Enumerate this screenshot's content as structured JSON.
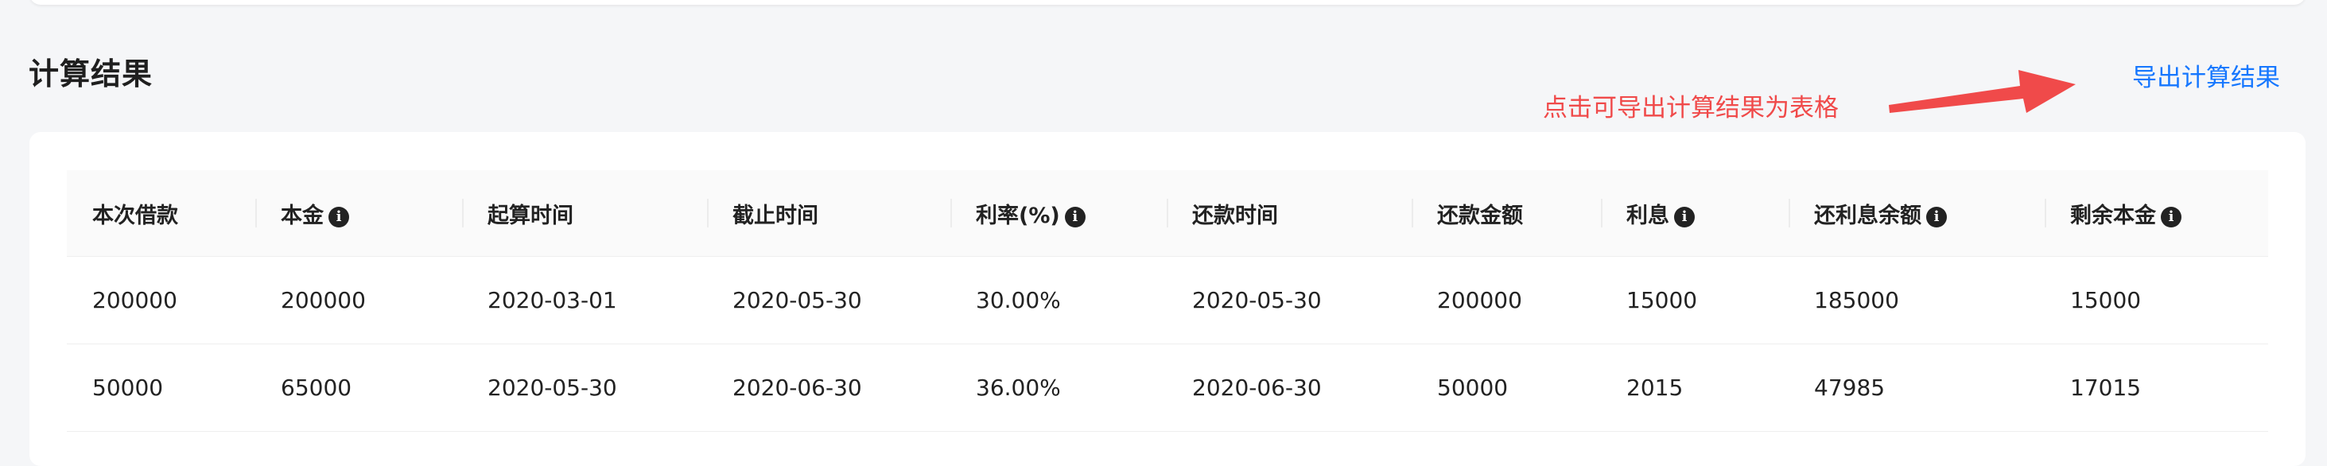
{
  "section": {
    "title": "计算结果"
  },
  "export": {
    "label": "导出计算结果"
  },
  "hint": {
    "text": "点击可导出计算结果为表格",
    "color": "#f04a4a"
  },
  "accent_color": "#1677ff",
  "table": {
    "columns": [
      {
        "label": "本次借款",
        "info": false
      },
      {
        "label": "本金",
        "info": true
      },
      {
        "label": "起算时间",
        "info": false
      },
      {
        "label": "截止时间",
        "info": false
      },
      {
        "label": "利率(%)",
        "info": true
      },
      {
        "label": "还款时间",
        "info": false
      },
      {
        "label": "还款金额",
        "info": false
      },
      {
        "label": "利息",
        "info": true
      },
      {
        "label": "还利息余额",
        "info": true
      },
      {
        "label": "剩余本金",
        "info": true
      }
    ],
    "info_icon": "info-circle-icon",
    "info_glyph": "i",
    "rows": [
      [
        "200000",
        "200000",
        "2020-03-01",
        "2020-05-30",
        "30.00%",
        "2020-05-30",
        "200000",
        "15000",
        "185000",
        "15000"
      ],
      [
        "50000",
        "65000",
        "2020-05-30",
        "2020-06-30",
        "36.00%",
        "2020-06-30",
        "50000",
        "2015",
        "47985",
        "17015"
      ]
    ]
  }
}
